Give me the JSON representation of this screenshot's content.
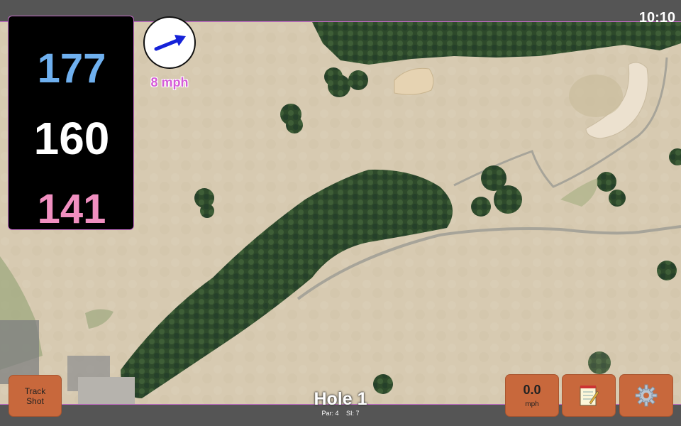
{
  "status": {
    "time": "10:10"
  },
  "distances": {
    "back": "177",
    "middle": "160",
    "front": "141"
  },
  "wind": {
    "speed_label": "8 mph",
    "arrow_color": "#1522d8"
  },
  "buttons": {
    "track_shot_line1": "Track",
    "track_shot_line2": "Shot",
    "speed_value": "0.0",
    "speed_unit": "mph",
    "notes_icon": "notepad-icon",
    "settings_icon": "gear-icon"
  },
  "hole": {
    "title": "Hole 1",
    "par": "Par: 4",
    "si": "SI: 7"
  },
  "colors": {
    "accent": "#c8683c",
    "back_distance": "#6fb0ef",
    "middle_distance": "#ffffff",
    "front_distance": "#f08fc0",
    "fairway": "#d9cdb4",
    "trees": "#2f4a2c"
  }
}
